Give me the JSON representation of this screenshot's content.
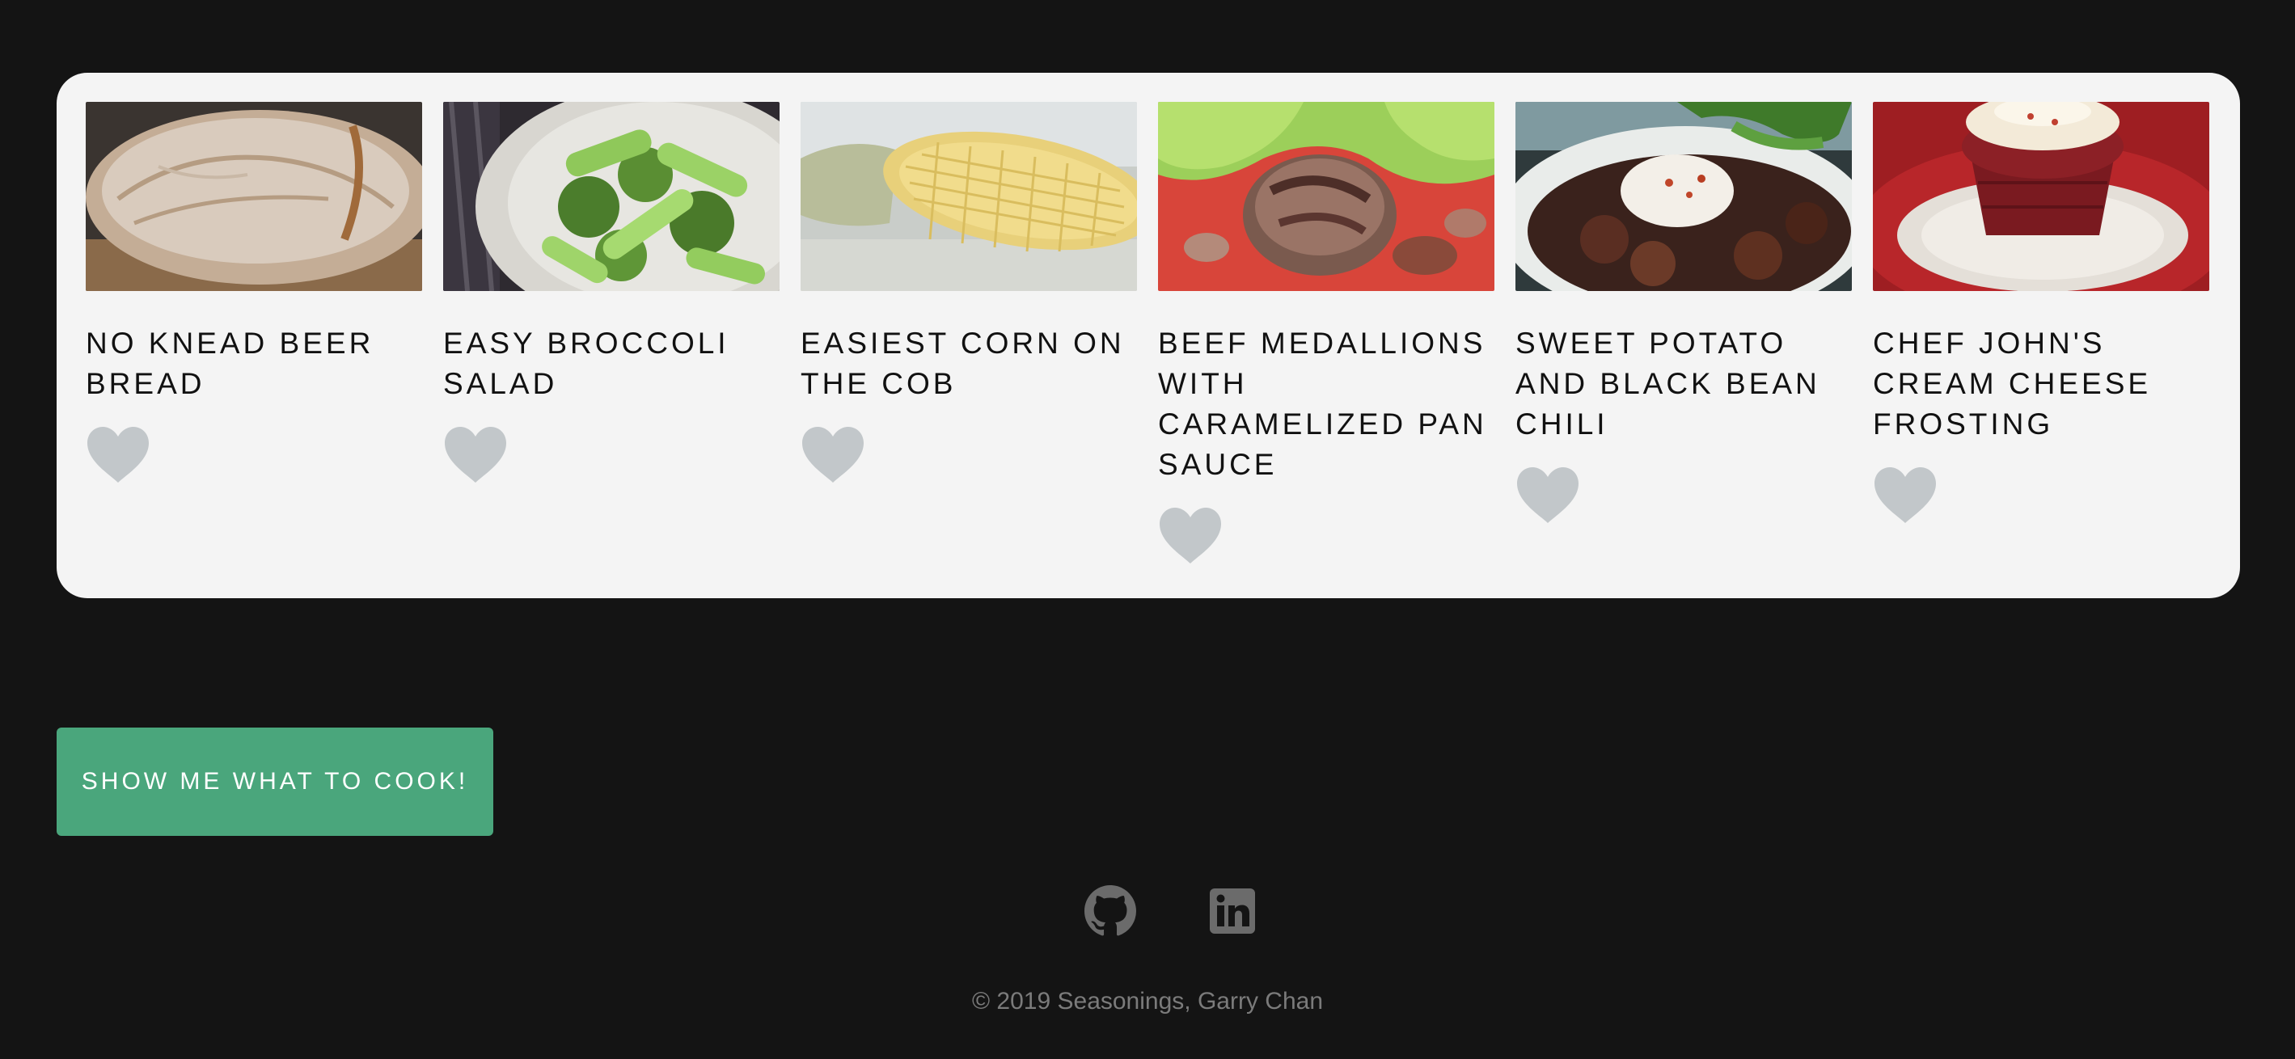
{
  "recipes": [
    {
      "title": "No Knead Beer Bread",
      "image_icon": "bread-photo-icon",
      "favorited": false
    },
    {
      "title": "Easy Broccoli Salad",
      "image_icon": "broccoli-salad-photo-icon",
      "favorited": false
    },
    {
      "title": "Easiest Corn on the Cob",
      "image_icon": "corn-photo-icon",
      "favorited": false
    },
    {
      "title": "Beef Medallions with Caramelized Pan Sauce",
      "image_icon": "beef-medallions-photo-icon",
      "favorited": false
    },
    {
      "title": "Sweet Potato and Black Bean Chili",
      "image_icon": "chili-photo-icon",
      "favorited": false
    },
    {
      "title": "Chef John's Cream Cheese Frosting",
      "image_icon": "cupcake-photo-icon",
      "favorited": false
    }
  ],
  "cta": {
    "label": "Show me what to cook!"
  },
  "social": {
    "github_icon": "github-icon",
    "linkedin_icon": "linkedin-icon"
  },
  "footer": {
    "copyright": "© 2019 Seasonings, Garry Chan"
  },
  "colors": {
    "page_background": "#141414",
    "panel_background": "#f4f4f4",
    "accent_green": "#4aa67c",
    "heart_inactive": "#c2c7ca",
    "social_icon": "#6b6b6b",
    "footer_text": "#7b7b7b"
  }
}
